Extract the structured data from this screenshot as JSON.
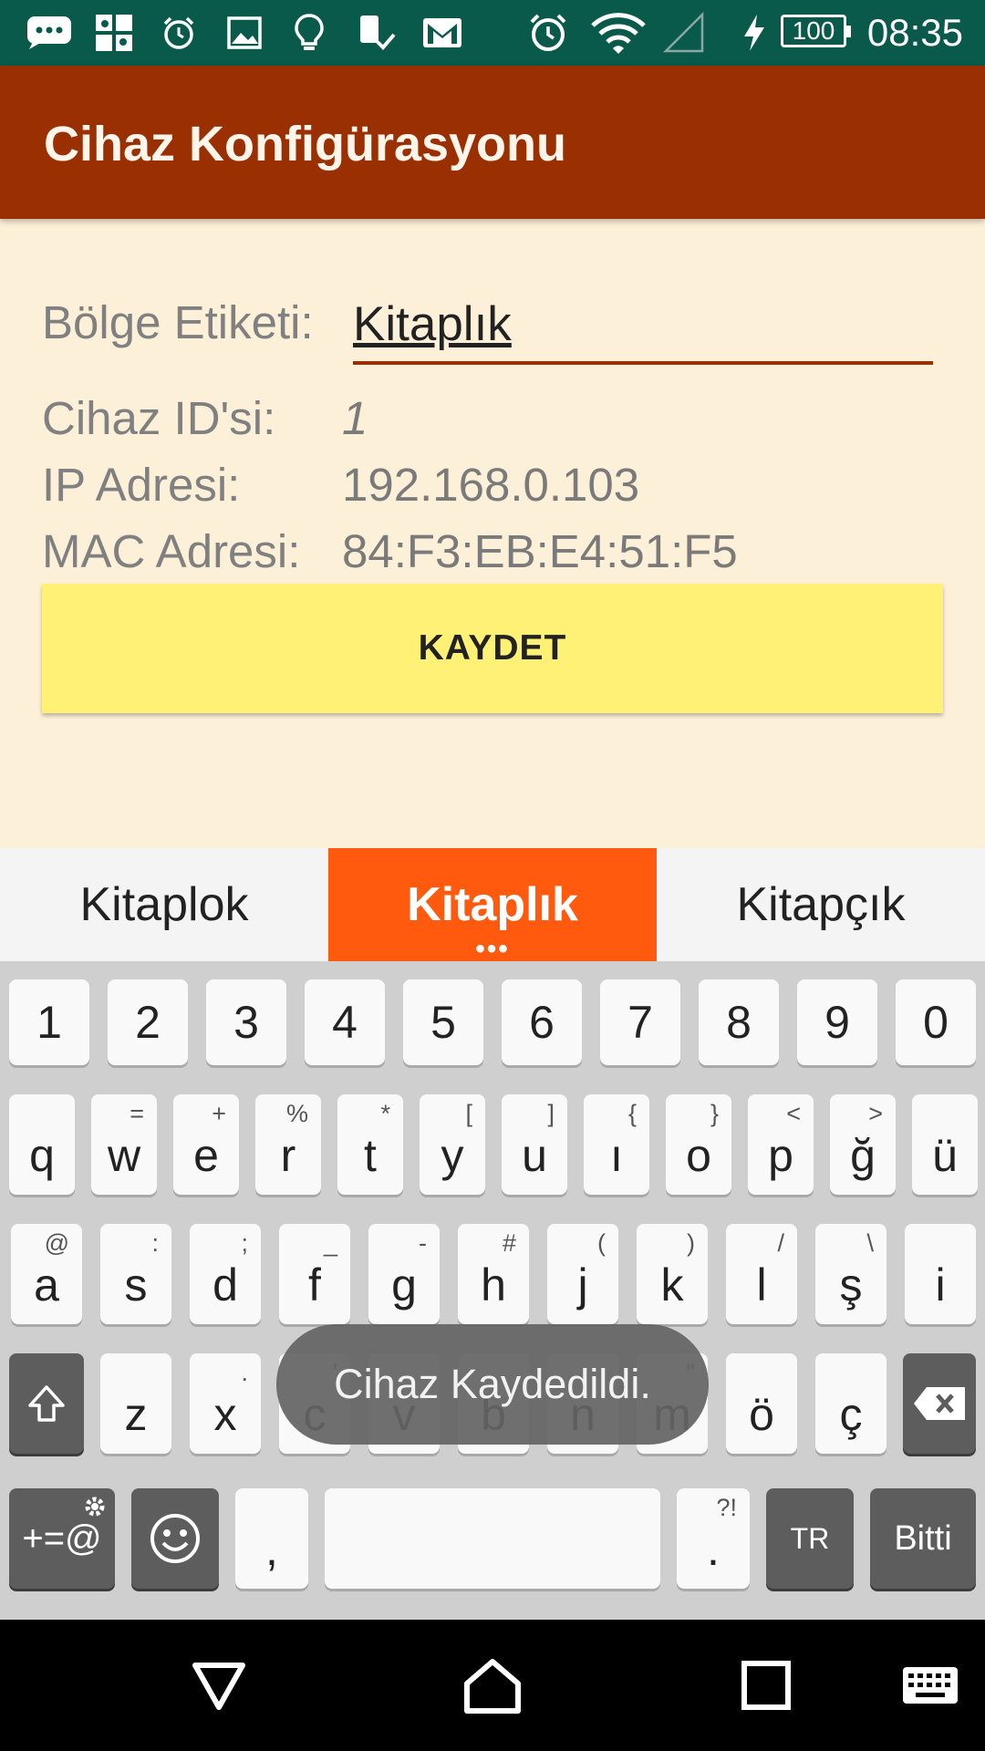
{
  "status_bar": {
    "time": "08:35",
    "battery": "100",
    "icons": [
      "chat-icon",
      "puzzle-icon",
      "alarm-icon",
      "image-icon",
      "bulb-icon",
      "sim-icon",
      "gmail-icon",
      "alarm-clock-icon",
      "wifi-icon",
      "signal-icon",
      "charging-icon"
    ]
  },
  "app_bar": {
    "title": "Cihaz Konfigürasyonu"
  },
  "form": {
    "zone_label": "Bölge Etiketi:",
    "zone_value": "Kitaplık",
    "device_id_label": "Cihaz ID'si:",
    "device_id_value": "1",
    "ip_label": "IP Adresi:",
    "ip_value": "192.168.0.103",
    "mac_label": "MAC Adresi:",
    "mac_value": "84:F3:EB:E4:51:F5",
    "save_label": "KAYDET"
  },
  "keyboard": {
    "suggestions": [
      "Kitaplok",
      "Kitaplık",
      "Kitapçık"
    ],
    "numbers": [
      "1",
      "2",
      "3",
      "4",
      "5",
      "6",
      "7",
      "8",
      "9",
      "0"
    ],
    "row1": [
      {
        "k": "q",
        "s": ""
      },
      {
        "k": "w",
        "s": "="
      },
      {
        "k": "e",
        "s": "+"
      },
      {
        "k": "r",
        "s": "%"
      },
      {
        "k": "t",
        "s": "*"
      },
      {
        "k": "y",
        "s": "["
      },
      {
        "k": "u",
        "s": "]"
      },
      {
        "k": "ı",
        "s": "{"
      },
      {
        "k": "o",
        "s": "}"
      },
      {
        "k": "p",
        "s": "<"
      },
      {
        "k": "ğ",
        "s": ">"
      },
      {
        "k": "ü",
        "s": ""
      }
    ],
    "row2": [
      {
        "k": "a",
        "s": "@"
      },
      {
        "k": "s",
        "s": ":"
      },
      {
        "k": "d",
        "s": ";"
      },
      {
        "k": "f",
        "s": "_"
      },
      {
        "k": "g",
        "s": "-"
      },
      {
        "k": "h",
        "s": "#"
      },
      {
        "k": "j",
        "s": "("
      },
      {
        "k": "k",
        "s": ")"
      },
      {
        "k": "l",
        "s": "/"
      },
      {
        "k": "ş",
        "s": "\\"
      },
      {
        "k": "i",
        "s": ""
      }
    ],
    "row3": [
      {
        "k": "z",
        "s": ""
      },
      {
        "k": "x",
        "s": "."
      },
      {
        "k": "c",
        "s": "'"
      },
      {
        "k": "v",
        "s": ""
      },
      {
        "k": "b",
        "s": ""
      },
      {
        "k": "n",
        "s": ""
      },
      {
        "k": "m",
        "s": "\""
      },
      {
        "k": "ö",
        "s": ""
      },
      {
        "k": "ç",
        "s": ""
      }
    ],
    "symbols_label": "+=@",
    "comma": ",",
    "period": ".",
    "period_sub": "?!",
    "language": "TR",
    "done": "Bitti"
  },
  "toast": {
    "text": "Cihaz Kaydedildi."
  }
}
